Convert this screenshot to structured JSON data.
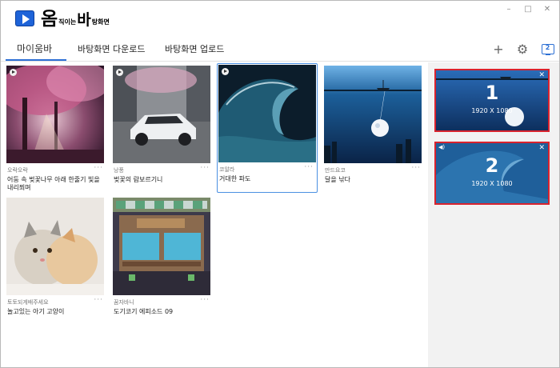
{
  "app": {
    "logo_big_1": "옴",
    "logo_small_1": "직이는",
    "logo_mid": "바",
    "logo_small_2": "탕화면",
    "window_controls": [
      "–",
      "□",
      "✕"
    ]
  },
  "tabs": [
    {
      "label": "마이움바",
      "active": true
    },
    {
      "label": "바탕화면 다운로드",
      "active": false
    },
    {
      "label": "바탕화면 업로드",
      "active": false
    }
  ],
  "toolbar": {
    "add_icon": "plus-icon",
    "settings_icon": "gear-icon",
    "monitor_icon": "monitor-icon",
    "monitor_count": "2"
  },
  "wallpapers": [
    {
      "author": "오락오락",
      "title": "어둠 속 벚꽃나무 아래 한줄기 빛을 내리쬐며",
      "selected": false,
      "has_play": true
    },
    {
      "author": "낭풍",
      "title": "벚꽃의 람보르기니",
      "selected": false,
      "has_play": true
    },
    {
      "author": "코알라",
      "title": "거대한 파도",
      "selected": true,
      "has_play": true
    },
    {
      "author": "만드요코",
      "title": "달을 낚다",
      "selected": false,
      "has_play": false
    },
    {
      "author": "토토되게배주세요",
      "title": "놀고있는 아기 고양이",
      "selected": false,
      "has_play": false
    },
    {
      "author": "꿈자바니",
      "title": "도기코기 에피소드 09",
      "selected": false,
      "has_play": false
    }
  ],
  "more_label": "···",
  "monitors": [
    {
      "number": "1",
      "resolution": "1920 X 1080",
      "close": "✕"
    },
    {
      "number": "2",
      "resolution": "1920 X 1080",
      "close": "✕",
      "sound": "◀)"
    }
  ],
  "colors": {
    "accent": "#2c6fd4",
    "selected_border": "#4a90e2",
    "monitor_border": "#d9232e",
    "side_panel_bg": "#f2f2f2"
  }
}
